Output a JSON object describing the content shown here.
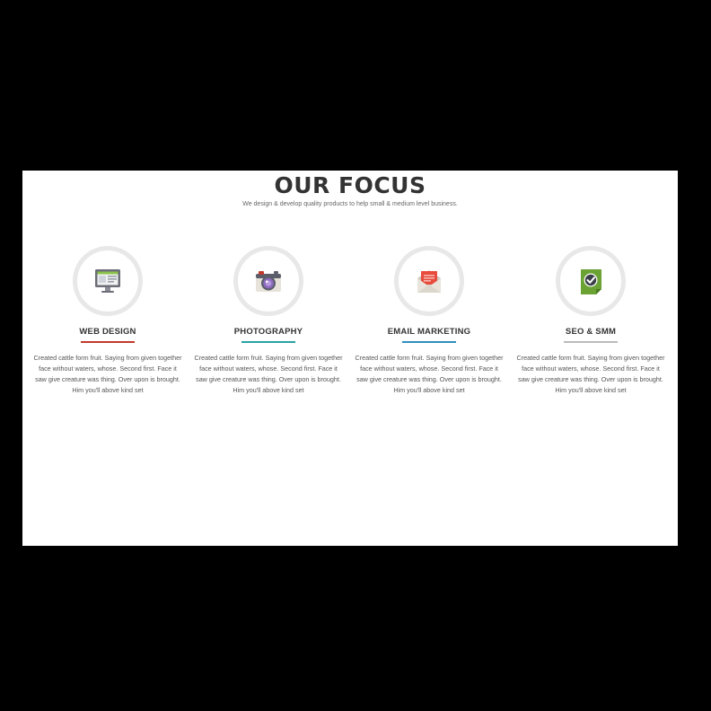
{
  "section": {
    "title": "OUR FOCUS",
    "subtitle": "We design & develop quality products to help small & medium level business."
  },
  "features": [
    {
      "title": "WEB DESIGN",
      "icon": "monitor-icon",
      "accent": "#c0392b",
      "description": "Created cattle form fruit. Saying from given together face without waters, whose. Second first. Face it saw give creature was thing. Over upon is brought. Him you'll above kind set"
    },
    {
      "title": "PHOTOGRAPHY",
      "icon": "camera-icon",
      "accent": "#2aa3a3",
      "description": "Created cattle form fruit. Saying from given together face without waters, whose. Second first. Face it saw give creature was thing. Over upon is brought. Him you'll above kind set"
    },
    {
      "title": "EMAIL MARKETING",
      "icon": "envelope-icon",
      "accent": "#2f8fbf",
      "description": "Created cattle form fruit. Saying from given together face without waters, whose. Second first. Face it saw give creature was thing. Over upon is brought. Him you'll above kind set"
    },
    {
      "title": "SEO & SMM",
      "icon": "checkmark-badge-icon",
      "accent": "#bbbbbb",
      "description": "Created cattle form fruit. Saying from given together face without waters, whose. Second first. Face it saw give creature was thing. Over upon is brought. Him you'll above kind set"
    }
  ]
}
